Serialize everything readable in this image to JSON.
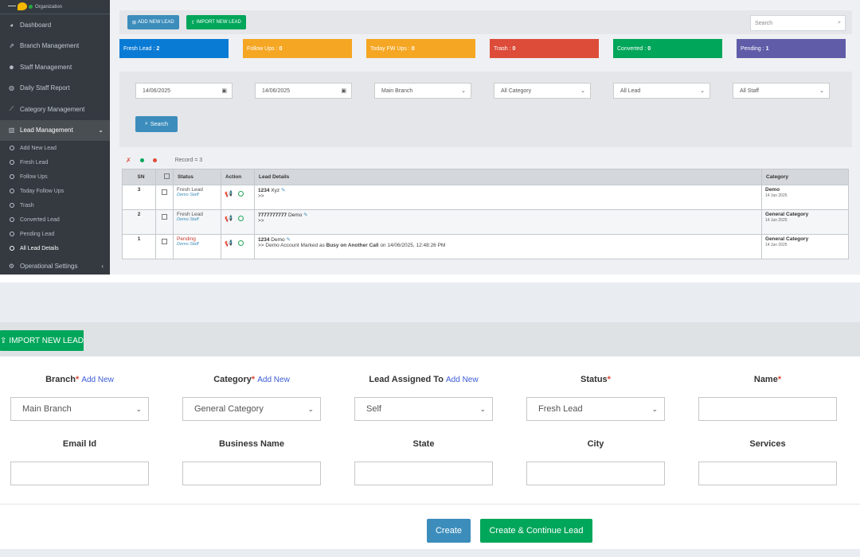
{
  "sidebar": {
    "org": "Organization",
    "items": [
      {
        "label": "Dashboard",
        "icon": "tachometer-icon"
      },
      {
        "label": "Branch Management",
        "icon": "share-icon"
      },
      {
        "label": "Staff Management",
        "icon": "user-plus-icon"
      },
      {
        "label": "Daily Staff Report",
        "icon": "globe-icon"
      },
      {
        "label": "Category Management",
        "icon": "chart-line-icon"
      }
    ],
    "lead_management": "Lead Management",
    "sub_items": [
      "Add New Lead",
      "Fresh Lead",
      "Follow Ups",
      "Today Follow Ups",
      "Trash",
      "Converted Lead",
      "Pending Lead",
      "All Lead Details"
    ],
    "operational": "Operational Settings"
  },
  "toolbar": {
    "add_new_lead": "ADD NEW LEAD",
    "import_new_lead": "IMPORT NEW LEAD",
    "search_placeholder": "Search"
  },
  "cards": [
    {
      "label": "Fresh Lead :",
      "count": "2",
      "color": "#0a7bd5"
    },
    {
      "label": "Follow Ups :",
      "count": "0",
      "color": "#f5a623"
    },
    {
      "label": "Today FW Ups :",
      "count": "0",
      "color": "#f5a623"
    },
    {
      "label": "Trash :",
      "count": "0",
      "color": "#dd4b39"
    },
    {
      "label": "Converted :",
      "count": "0",
      "color": "#00a65a"
    },
    {
      "label": "Pending :",
      "count": "1",
      "color": "#605ca8"
    }
  ],
  "filters": {
    "date_from": "14/06/2025",
    "date_to": "14/06/2025",
    "branch": "Main Branch",
    "category": "All Category",
    "lead": "All Lead",
    "staff": "All Staff",
    "search_button": "Search"
  },
  "record_count": "Record = 3",
  "table": {
    "headers": [
      "SN",
      "",
      "Status",
      "Action",
      "Lead Details",
      "Category"
    ],
    "rows": [
      {
        "sn": "3",
        "status": "Fresh Lead",
        "staff": "Demo Staff",
        "number": "1234",
        "name": "Xyz",
        "detail": ">>",
        "detail_bold": "",
        "detail_tail": "",
        "category": "Demo",
        "date": "14 Jun 2025"
      },
      {
        "sn": "2",
        "status": "Fresh Lead",
        "staff": "Demo Staff",
        "number": "7777777777",
        "name": "Demo",
        "detail": ">>",
        "detail_bold": "",
        "detail_tail": "",
        "category": "General Category",
        "date": "14 Jun 2025"
      },
      {
        "sn": "1",
        "status": "Pending",
        "staff": "Demo Staff",
        "number": "1234",
        "name": "Demo",
        "detail": ">> Demo Account Marked as",
        "detail_bold": "Busy on Another Call",
        "detail_tail": "on 14/06/2025, 12:48:26 PM",
        "category": "General Category",
        "date": "14 Jun 2025"
      }
    ]
  },
  "form": {
    "import_button": "IMPORT NEW LEAD",
    "add_new": "Add New",
    "branch_label": "Branch",
    "branch_value": "Main Branch",
    "category_label": "Category",
    "category_value": "General Category",
    "assigned_label": "Lead Assigned To",
    "assigned_value": "Self",
    "status_label": "Status",
    "status_value": "Fresh Lead",
    "name_label": "Name",
    "email_label": "Email Id",
    "business_label": "Business Name",
    "state_label": "State",
    "city_label": "City",
    "services_label": "Services",
    "create_button": "Create",
    "create_continue_button": "Create & Continue Lead"
  }
}
